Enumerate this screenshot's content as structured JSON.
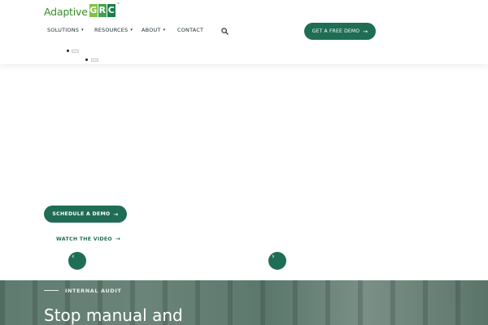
{
  "brand": {
    "logo_word": "Adaptive",
    "logo_letters": [
      "G",
      "R",
      "C"
    ],
    "logo_tm": "™",
    "colors": {
      "primary": "#1f6d55",
      "logo_green_light": "#7fc241",
      "logo_green_mid": "#3fa14a",
      "logo_green_dark": "#1f7a4c"
    }
  },
  "nav": {
    "items": [
      {
        "label": "SOLUTIONS",
        "has_dropdown": true
      },
      {
        "label": "RESOURCES",
        "has_dropdown": true
      },
      {
        "label": "ABOUT",
        "has_dropdown": true
      },
      {
        "label": "CONTACT",
        "has_dropdown": false
      }
    ],
    "caret": "▾",
    "search_icon": "search-icon"
  },
  "header_cta": {
    "label": "GET A FREE DEMO",
    "arrow": "→"
  },
  "hero_cta": {
    "schedule_label": "SCHEDULE A DEMO",
    "watch_label": "WATCH THE VIDEO",
    "arrow": "→"
  },
  "slider": {
    "prev_icon": "chevron-left-icon",
    "next_icon": "chevron-right-icon",
    "prev_glyph": "‹",
    "next_glyph": "›"
  },
  "hero": {
    "kicker": "INTERNAL AUDIT",
    "title": "Stop manual and"
  }
}
